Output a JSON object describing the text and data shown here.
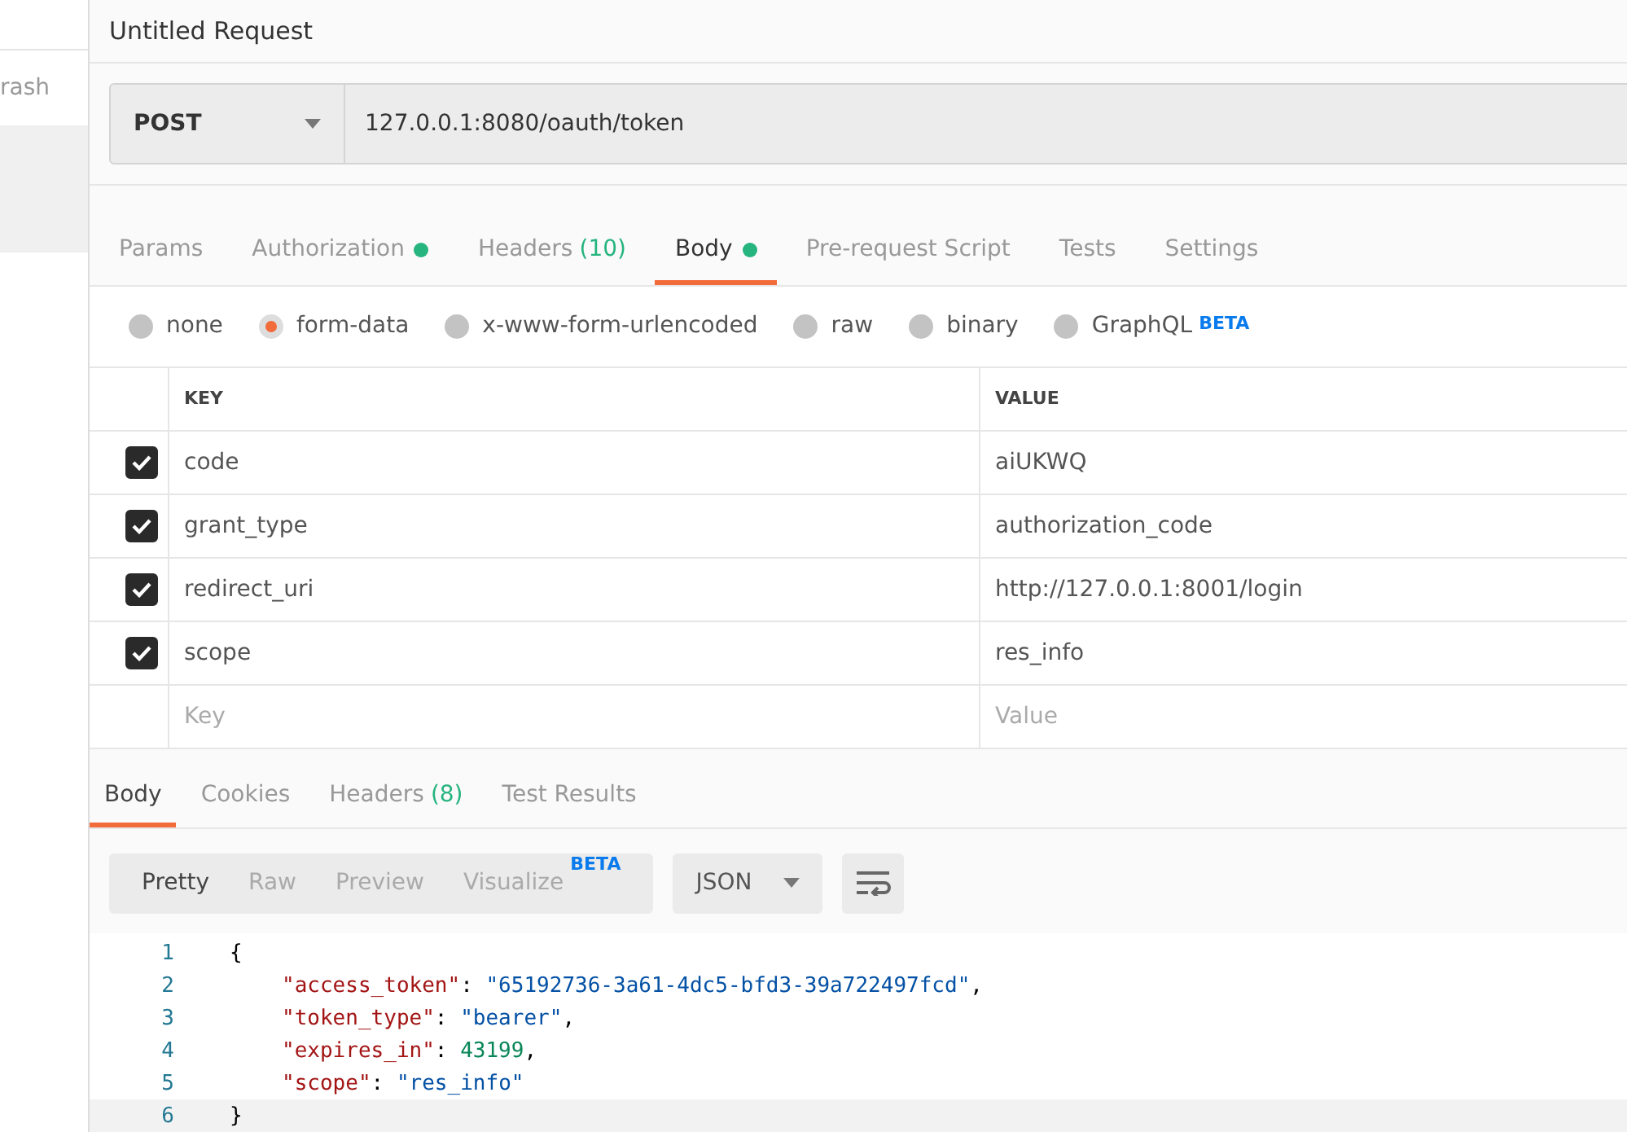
{
  "sidebar": {
    "items": [
      {
        "label": "rash",
        "selected": false
      },
      {
        "selected": true
      }
    ]
  },
  "request": {
    "title": "Untitled Request",
    "method": "POST",
    "url": "127.0.0.1:8080/oauth/token"
  },
  "tabs": [
    {
      "label": "Params",
      "selected": false
    },
    {
      "label": "Authorization",
      "dot": true,
      "selected": false
    },
    {
      "label": "Headers",
      "count": "(10)",
      "selected": false
    },
    {
      "label": "Body",
      "dot": true,
      "selected": true
    },
    {
      "label": "Pre-request Script",
      "selected": false
    },
    {
      "label": "Tests",
      "selected": false
    },
    {
      "label": "Settings",
      "selected": false
    }
  ],
  "body_types": [
    {
      "label": "none",
      "selected": false
    },
    {
      "label": "form-data",
      "selected": true
    },
    {
      "label": "x-www-form-urlencoded",
      "selected": false
    },
    {
      "label": "raw",
      "selected": false
    },
    {
      "label": "binary",
      "selected": false
    },
    {
      "label": "GraphQL",
      "badge": "BETA",
      "selected": false
    }
  ],
  "table": {
    "columns": [
      "KEY",
      "VALUE"
    ],
    "rows": [
      {
        "key": "code",
        "value": "aiUKWQ",
        "checked": true
      },
      {
        "key": "grant_type",
        "value": "authorization_code",
        "checked": true
      },
      {
        "key": "redirect_uri",
        "value": "http://127.0.0.1:8001/login",
        "checked": true
      },
      {
        "key": "scope",
        "value": "res_info",
        "checked": true
      }
    ],
    "new_row": {
      "key_placeholder": "Key",
      "value_placeholder": "Value"
    }
  },
  "response_tabs": [
    {
      "label": "Body",
      "selected": true
    },
    {
      "label": "Cookies",
      "selected": false
    },
    {
      "label": "Headers",
      "count": "(8)",
      "selected": false
    },
    {
      "label": "Test Results",
      "selected": false
    }
  ],
  "view_modes": [
    {
      "label": "Pretty",
      "selected": true
    },
    {
      "label": "Raw",
      "selected": false
    },
    {
      "label": "Preview",
      "selected": false
    },
    {
      "label": "Visualize",
      "badge": "BETA",
      "selected": false
    }
  ],
  "format": "JSON",
  "code_lines": [
    {
      "number": "1",
      "tokens": [
        {
          "kind": "punct",
          "text": "{"
        }
      ]
    },
    {
      "number": "2",
      "tokens": [
        {
          "kind": "key",
          "text": "\"access_token\""
        },
        {
          "kind": "punct",
          "text": ": "
        },
        {
          "kind": "string",
          "text": "\"65192736-3a61-4dc5-bfd3-39a722497fcd\""
        },
        {
          "kind": "punct",
          "text": ","
        }
      ]
    },
    {
      "number": "3",
      "tokens": [
        {
          "kind": "key",
          "text": "\"token_type\""
        },
        {
          "kind": "punct",
          "text": ": "
        },
        {
          "kind": "string",
          "text": "\"bearer\""
        },
        {
          "kind": "punct",
          "text": ","
        }
      ]
    },
    {
      "number": "4",
      "tokens": [
        {
          "kind": "key",
          "text": "\"expires_in\""
        },
        {
          "kind": "punct",
          "text": ": "
        },
        {
          "kind": "number",
          "text": "43199"
        },
        {
          "kind": "punct",
          "text": ","
        }
      ]
    },
    {
      "number": "5",
      "tokens": [
        {
          "kind": "key",
          "text": "\"scope\""
        },
        {
          "kind": "punct",
          "text": ": "
        },
        {
          "kind": "string",
          "text": "\"res_info\""
        }
      ]
    },
    {
      "number": "6",
      "tokens": [
        {
          "kind": "punct",
          "text": "}"
        }
      ]
    }
  ]
}
